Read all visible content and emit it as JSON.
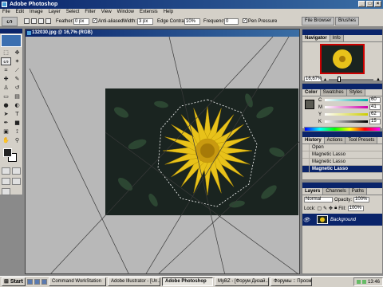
{
  "app": {
    "title": "Adobe Photoshop"
  },
  "menu": [
    "File",
    "Edit",
    "Image",
    "Layer",
    "Select",
    "Filter",
    "View",
    "Window",
    "Extensis",
    "Help"
  ],
  "options": {
    "feather_label": "Feather:",
    "feather_value": "0 px",
    "anti_aliased_label": "Anti-aliased",
    "width_label": "Width:",
    "width_value": "3 px",
    "edge_contrast_label": "Edge Contrast:",
    "edge_contrast_value": "10%",
    "frequency_label": "Frequency:",
    "frequency_value": "0",
    "pen_pressure_label": "Pen Pressure",
    "file_browser": "File Browser",
    "brushes": "Brushes"
  },
  "document": {
    "title": "132030.jpg @ 16,7% (RGB)"
  },
  "navigator": {
    "tabs": [
      "Navigator",
      "Info"
    ],
    "zoom": "16,67%"
  },
  "color_panel": {
    "tabs": [
      "Color",
      "Swatches",
      "Styles"
    ],
    "channels": [
      {
        "label": "C",
        "value": "60"
      },
      {
        "label": "M",
        "value": "41"
      },
      {
        "label": "Y",
        "value": "62"
      },
      {
        "label": "K",
        "value": "15"
      }
    ]
  },
  "history": {
    "tabs": [
      "History",
      "Actions",
      "Tool Presets"
    ],
    "items": [
      "Open",
      "Magnetic Lasso",
      "Magnetic Lasso",
      "Magnetic Lasso"
    ]
  },
  "layers": {
    "tabs": [
      "Layers",
      "Channels",
      "Paths"
    ],
    "blend_mode": "Normal",
    "opacity_label": "Opacity:",
    "opacity_value": "100%",
    "lock_label": "Lock:",
    "fill_label": "Fill:",
    "fill_value": "100%",
    "layer_name": "Background"
  },
  "taskbar": {
    "start": "Start",
    "tasks": [
      "Command WorkStation",
      "Adobe Illustrator - [Un...",
      "Adobe Photoshop",
      "MyBZ - [Форум Дизай...",
      "Форумы :: Просм..."
    ],
    "clock": "13:46"
  },
  "colors": {
    "title_bar": "#0a246a",
    "chrome": "#d4d0c8",
    "flower": "#e8c21a"
  }
}
